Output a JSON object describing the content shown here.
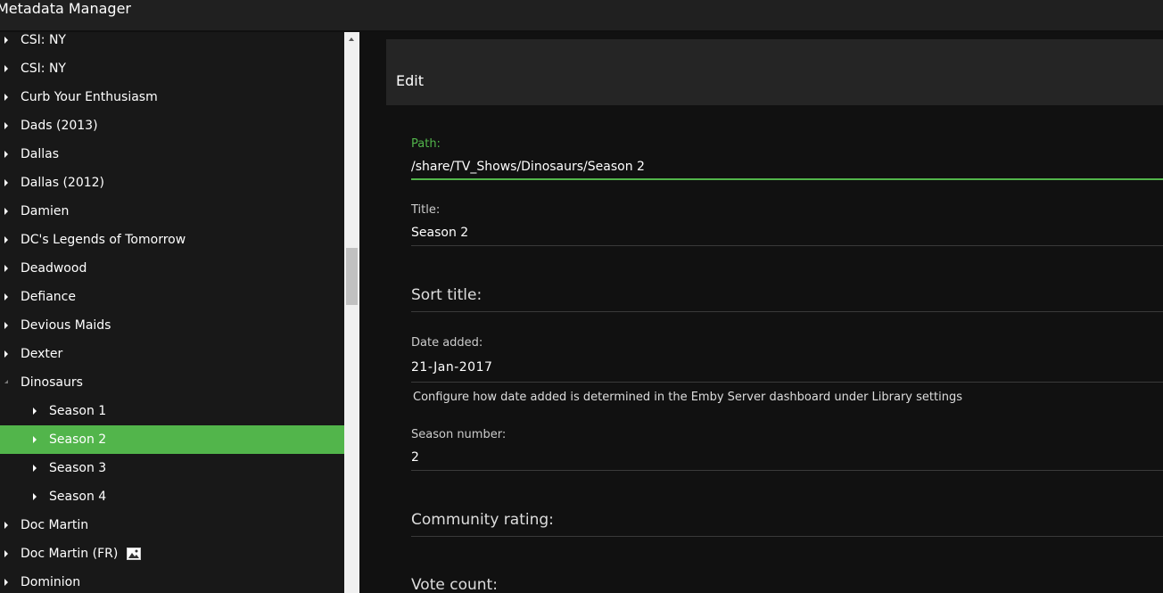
{
  "app": {
    "title": "Metadata Manager"
  },
  "tree": {
    "items": [
      {
        "label": "CSI: NY",
        "level": 0,
        "state": "collapsed"
      },
      {
        "label": "CSI: NY",
        "level": 0,
        "state": "collapsed"
      },
      {
        "label": "Curb Your Enthusiasm",
        "level": 0,
        "state": "collapsed"
      },
      {
        "label": "Dads (2013)",
        "level": 0,
        "state": "collapsed"
      },
      {
        "label": "Dallas",
        "level": 0,
        "state": "collapsed"
      },
      {
        "label": "Dallas (2012)",
        "level": 0,
        "state": "collapsed"
      },
      {
        "label": "Damien",
        "level": 0,
        "state": "collapsed"
      },
      {
        "label": "DC's Legends of Tomorrow",
        "level": 0,
        "state": "collapsed"
      },
      {
        "label": "Deadwood",
        "level": 0,
        "state": "collapsed"
      },
      {
        "label": "Defiance",
        "level": 0,
        "state": "collapsed"
      },
      {
        "label": "Devious Maids",
        "level": 0,
        "state": "collapsed"
      },
      {
        "label": "Dexter",
        "level": 0,
        "state": "collapsed"
      },
      {
        "label": "Dinosaurs",
        "level": 0,
        "state": "expanded"
      },
      {
        "label": "Season 1",
        "level": 1,
        "state": "collapsed"
      },
      {
        "label": "Season 2",
        "level": 1,
        "state": "collapsed",
        "selected": true
      },
      {
        "label": "Season 3",
        "level": 1,
        "state": "collapsed"
      },
      {
        "label": "Season 4",
        "level": 1,
        "state": "collapsed"
      },
      {
        "label": "Doc Martin",
        "level": 0,
        "state": "collapsed"
      },
      {
        "label": "Doc Martin (FR)",
        "level": 0,
        "state": "collapsed",
        "icon": "image-icon"
      },
      {
        "label": "Dominion",
        "level": 0,
        "state": "collapsed"
      }
    ]
  },
  "edit": {
    "heading": "Edit",
    "path_label": "Path:",
    "path_value": "/share/TV_Shows/Dinosaurs/Season 2",
    "title_label": "Title:",
    "title_value": "Season 2",
    "sort_title_label": "Sort title:",
    "date_added_label": "Date added:",
    "date_added_value": "21-Jan-2017",
    "date_hint": "Configure how date added is determined in the Emby Server dashboard under Library settings",
    "season_number_label": "Season number:",
    "season_number_value": "2",
    "community_rating_label": "Community rating:",
    "vote_count_label": "Vote count:"
  },
  "colors": {
    "accent": "#52b54b",
    "background": "#101010",
    "panel": "#181818",
    "header": "#252525"
  }
}
